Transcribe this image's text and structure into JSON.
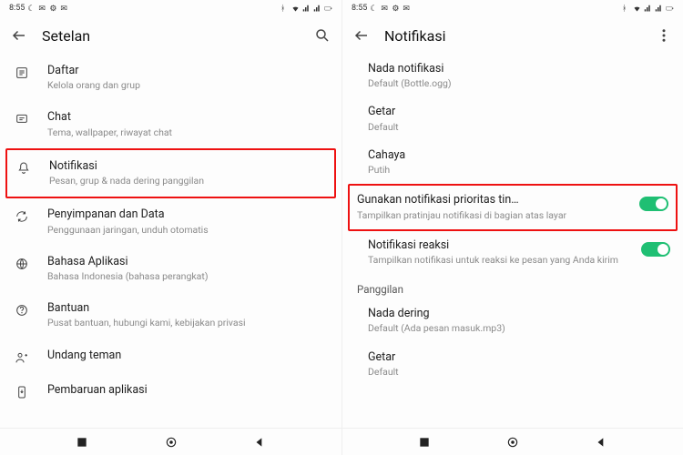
{
  "status": {
    "time": "8:55",
    "icons_left": [
      "moon",
      "chat",
      "gear",
      "msg",
      "dots"
    ],
    "icons_right": [
      "bt",
      "wifi",
      "sig",
      "sig",
      "batt"
    ]
  },
  "left": {
    "title": "Setelan",
    "items": [
      {
        "icon": "list",
        "label": "Daftar",
        "sub": "Kelola orang dan grup"
      },
      {
        "icon": "chat",
        "label": "Chat",
        "sub": "Tema, wallpaper, riwayat chat"
      },
      {
        "icon": "bell",
        "label": "Notifikasi",
        "sub": "Pesan, grup & nada dering panggilan",
        "hl": true
      },
      {
        "icon": "sync",
        "label": "Penyimpanan dan Data",
        "sub": "Penggunaan jaringan, unduh otomatis"
      },
      {
        "icon": "globe",
        "label": "Bahasa Aplikasi",
        "sub": "Bahasa Indonesia (bahasa perangkat)"
      },
      {
        "icon": "help",
        "label": "Bantuan",
        "sub": "Pusat bantuan, hubungi kami, kebijakan privasi"
      },
      {
        "icon": "invite",
        "label": "Undang teman",
        "sub": ""
      },
      {
        "icon": "update",
        "label": "Pembaruan aplikasi",
        "sub": ""
      }
    ]
  },
  "right": {
    "title": "Notifikasi",
    "rows": [
      {
        "type": "item",
        "label": "Nada notifikasi",
        "sub": "Default (Bottle.ogg)"
      },
      {
        "type": "item",
        "label": "Getar",
        "sub": "Default"
      },
      {
        "type": "item",
        "label": "Cahaya",
        "sub": "Putih"
      },
      {
        "type": "toggle",
        "label": "Gunakan notifikasi prioritas tin…",
        "sub": "Tampilkan pratinjau notifikasi di bagian atas layar",
        "on": true,
        "hl": true
      },
      {
        "type": "toggle",
        "label": "Notifikasi reaksi",
        "sub": "Tampilkan notifikasi untuk reaksi ke pesan yang Anda kirim",
        "on": true
      },
      {
        "type": "section",
        "label": "Panggilan"
      },
      {
        "type": "item",
        "label": "Nada dering",
        "sub": "Default (Ada pesan masuk.mp3)"
      },
      {
        "type": "item",
        "label": "Getar",
        "sub": "Default"
      }
    ]
  }
}
